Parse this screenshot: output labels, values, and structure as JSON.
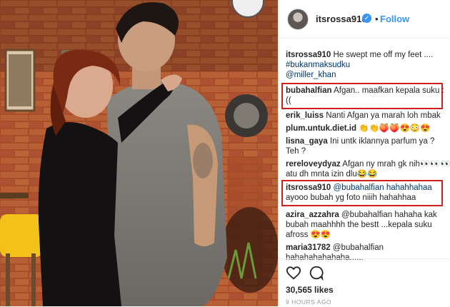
{
  "post": {
    "username": "itsrossa910",
    "verified_icon": "check-badge-icon",
    "separator": "•",
    "follow_label": "Follow"
  },
  "comments": [
    {
      "user": "itsrossa910",
      "lines": [
        "He swept me off my feet ...."
      ],
      "extra": [
        "#bukanmaksudku",
        "@miller_khan"
      ]
    },
    {
      "user": "bubahalfian",
      "lines": [
        "Afgan.. maafkan kepala suku :",
        "(("
      ]
    },
    {
      "user": "erik_luiss",
      "lines": [
        "Nanti Afgan ya marah loh mbak"
      ]
    },
    {
      "user": "plum.untuk.diet.id",
      "lines": [
        "👏👏🍑🍑😍😳😍"
      ]
    },
    {
      "user": "lisna_gaya",
      "lines": [
        "Ini untk iklannya parfum ya ?",
        "Teh ?"
      ]
    },
    {
      "user": "rereloveydyaz",
      "lines": [
        "Afgan ny mrah gk nih👀👀👀",
        "atu dh mnta izin dlu😂😂"
      ]
    },
    {
      "user": "itsrossa910",
      "lines": [
        "@bubahalfian hahahhahaa",
        "ayooo bubah yg foto niiih hahahhaa"
      ]
    },
    {
      "user": "azira_azzahra",
      "lines": [
        "@bubahalfian hahaha kak",
        "bubah maahhhh the bestt ...kepala suku",
        "afross 😍😍"
      ]
    },
    {
      "user": "maria31782",
      "lines": [
        "@bubahalfian",
        "hahahahahahaha......"
      ]
    }
  ],
  "actions": {
    "heart_icon": "heart-icon",
    "comment_icon": "comment-icon",
    "likes": "30,565 likes",
    "time": "9 HOURS AGO"
  }
}
